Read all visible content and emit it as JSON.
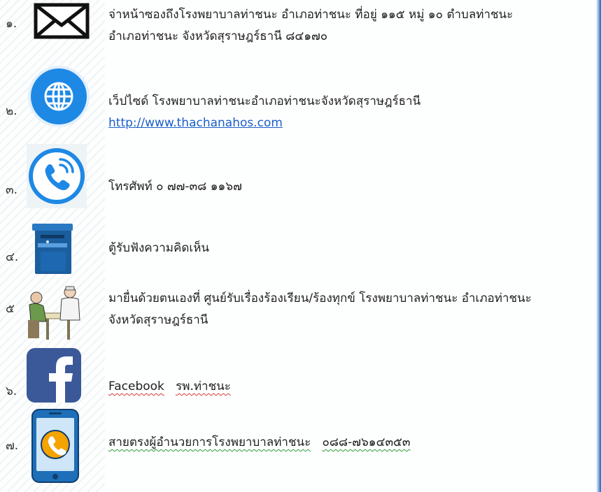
{
  "items": [
    {
      "number": "๑.",
      "icon": "envelope-icon",
      "line1": "จ่าหน้าซองถึงโรงพยาบาลท่าชนะ  อำเภอท่าชนะ ที่อยู่ ๑๑๕  หมู่ ๑๐  ตำบลท่าชนะ",
      "line2": "อำเภอท่าชนะ  จังหวัดสุราษฎร์ธานี ๘๔๑๗๐"
    },
    {
      "number": "๒.",
      "icon": "globe-icon",
      "line1": "เว็ปไซด์ โรงพยาบาลท่าชนะอำเภอท่าชนะจังหวัดสุราษฎร์ธานี",
      "link": "http://www.thachanahos.com"
    },
    {
      "number": "๓.",
      "icon": "phone-icon",
      "line1": "โทรศัพท์ ๐ ๗๗-๓๘ ๑๑๖๗"
    },
    {
      "number": "๔.",
      "icon": "comment-box-icon",
      "line1": "ตู้รับฟังความคิดเห็น"
    },
    {
      "number": "๕",
      "icon": "service-desk-icon",
      "line1": "มายื่นด้วยตนเองที่ ศูนย์รับเรื่องร้องเรียน/ร้องทุกข์ โรงพยาบาลท่าชนะ อำเภอท่าชนะ",
      "line2": "จังหวัดสุราษฎร์ธานี"
    },
    {
      "number": "๖.",
      "icon": "facebook-icon",
      "facebook_label": "Facebook",
      "facebook_page": "รพ.ท่าชนะ"
    },
    {
      "number": "๗.",
      "icon": "mobile-phone-icon",
      "line1": "สายตรงผู้อำนวยการโรงพยาบาลท่าชนะ",
      "phone": "๐๘๘-๗๖๑๔๓๕๓"
    }
  ],
  "colors": {
    "link": "#1a5fc7",
    "globe_bg": "#1e88e5",
    "phone_ring": "#1e88e5",
    "facebook": "#3b5998",
    "mobile_body": "#1e6fb8",
    "mobile_call": "#f4a300",
    "edge_accent": "#1565c0"
  }
}
